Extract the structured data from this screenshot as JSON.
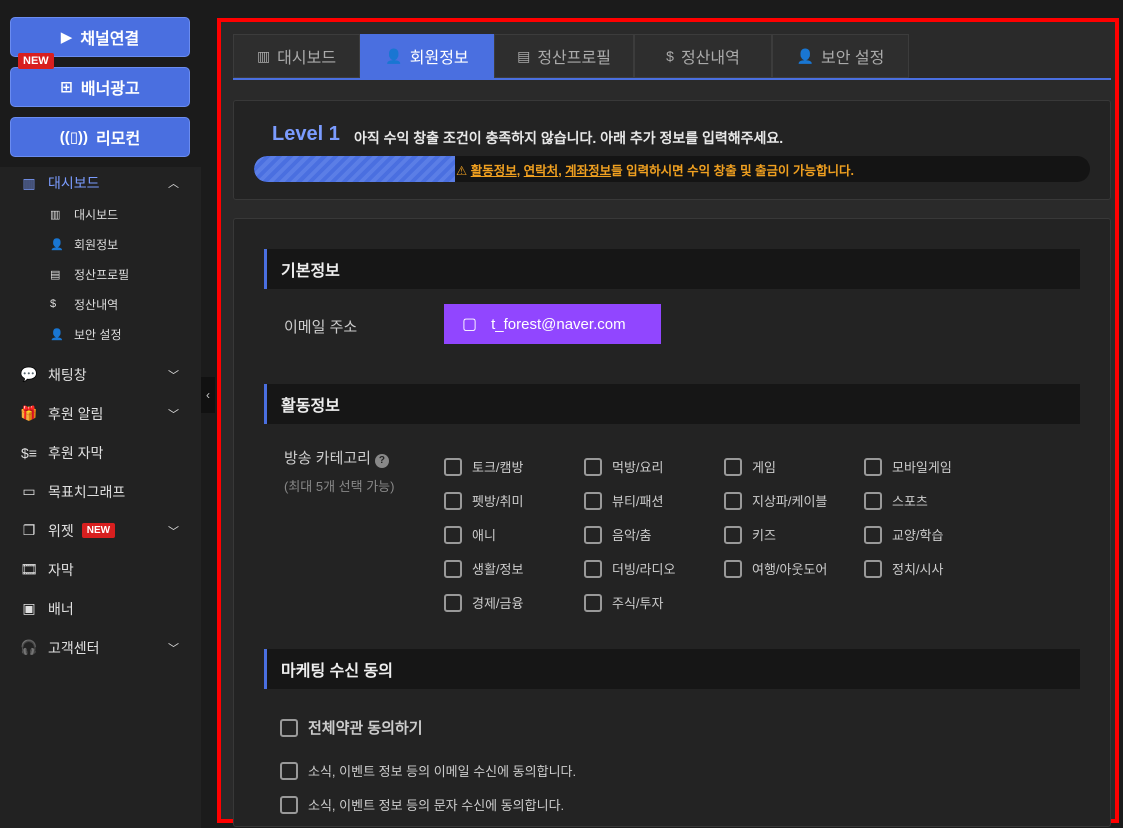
{
  "sidebar": {
    "top_buttons": {
      "channel_connect": "채널연결",
      "banner_ad": "배너광고",
      "remote": "리모컨",
      "new_badge": "NEW"
    },
    "dashboard": {
      "label": "대시보드",
      "sub": [
        "대시보드",
        "회원정보",
        "정산프로필",
        "정산내역",
        "보안 설정"
      ]
    },
    "items": [
      "채팅창",
      "후원 알림",
      "후원 자막",
      "목표치그래프",
      "위젯",
      "자막",
      "배너",
      "고객센터"
    ],
    "widget_new": "NEW"
  },
  "tabs": [
    "대시보드",
    "회원정보",
    "정산프로필",
    "정산내역",
    "보안 설정"
  ],
  "level": {
    "title": "Level 1",
    "message": "아직 수익 창출 조건이 충족하지 않습니다. 아래 추가 정보를 입력해주세요.",
    "progress": 0.24,
    "note_link1": "활동정보",
    "note_sep1": ",",
    "note_link2": "연락처",
    "note_sep2": ",",
    "note_link3": "계좌정보",
    "note_rest": "들 입력하시면 수익 창출 및 출금이 가능합니다."
  },
  "basic": {
    "heading": "기본정보",
    "email_label": "이메일 주소",
    "email": "t_forest@naver.com"
  },
  "activity": {
    "heading": "활동정보",
    "category_label": "방송 카테고리",
    "category_hint": "(최대 5개 선택 가능)",
    "categories": [
      "토크/캠방",
      "먹방/요리",
      "게임",
      "모바일게임",
      "펫방/취미",
      "뷰티/패션",
      "지상파/케이블",
      "스포츠",
      "애니",
      "음악/춤",
      "키즈",
      "교양/학습",
      "생활/정보",
      "더빙/라디오",
      "여행/아웃도어",
      "정치/시사",
      "경제/금융",
      "주식/투자"
    ]
  },
  "marketing": {
    "heading": "마케팅 수신 동의",
    "agree_all": "전체약관 동의하기",
    "email_agree": "소식, 이벤트 정보 등의 이메일 수신에 동의합니다.",
    "sms_agree": "소식, 이벤트 정보 등의 문자 수신에 동의합니다."
  },
  "colors": {
    "accent": "#4a6fe0",
    "twitch": "#9146ff",
    "warning": "#f0a020",
    "highlight_border": "#ff0000"
  }
}
